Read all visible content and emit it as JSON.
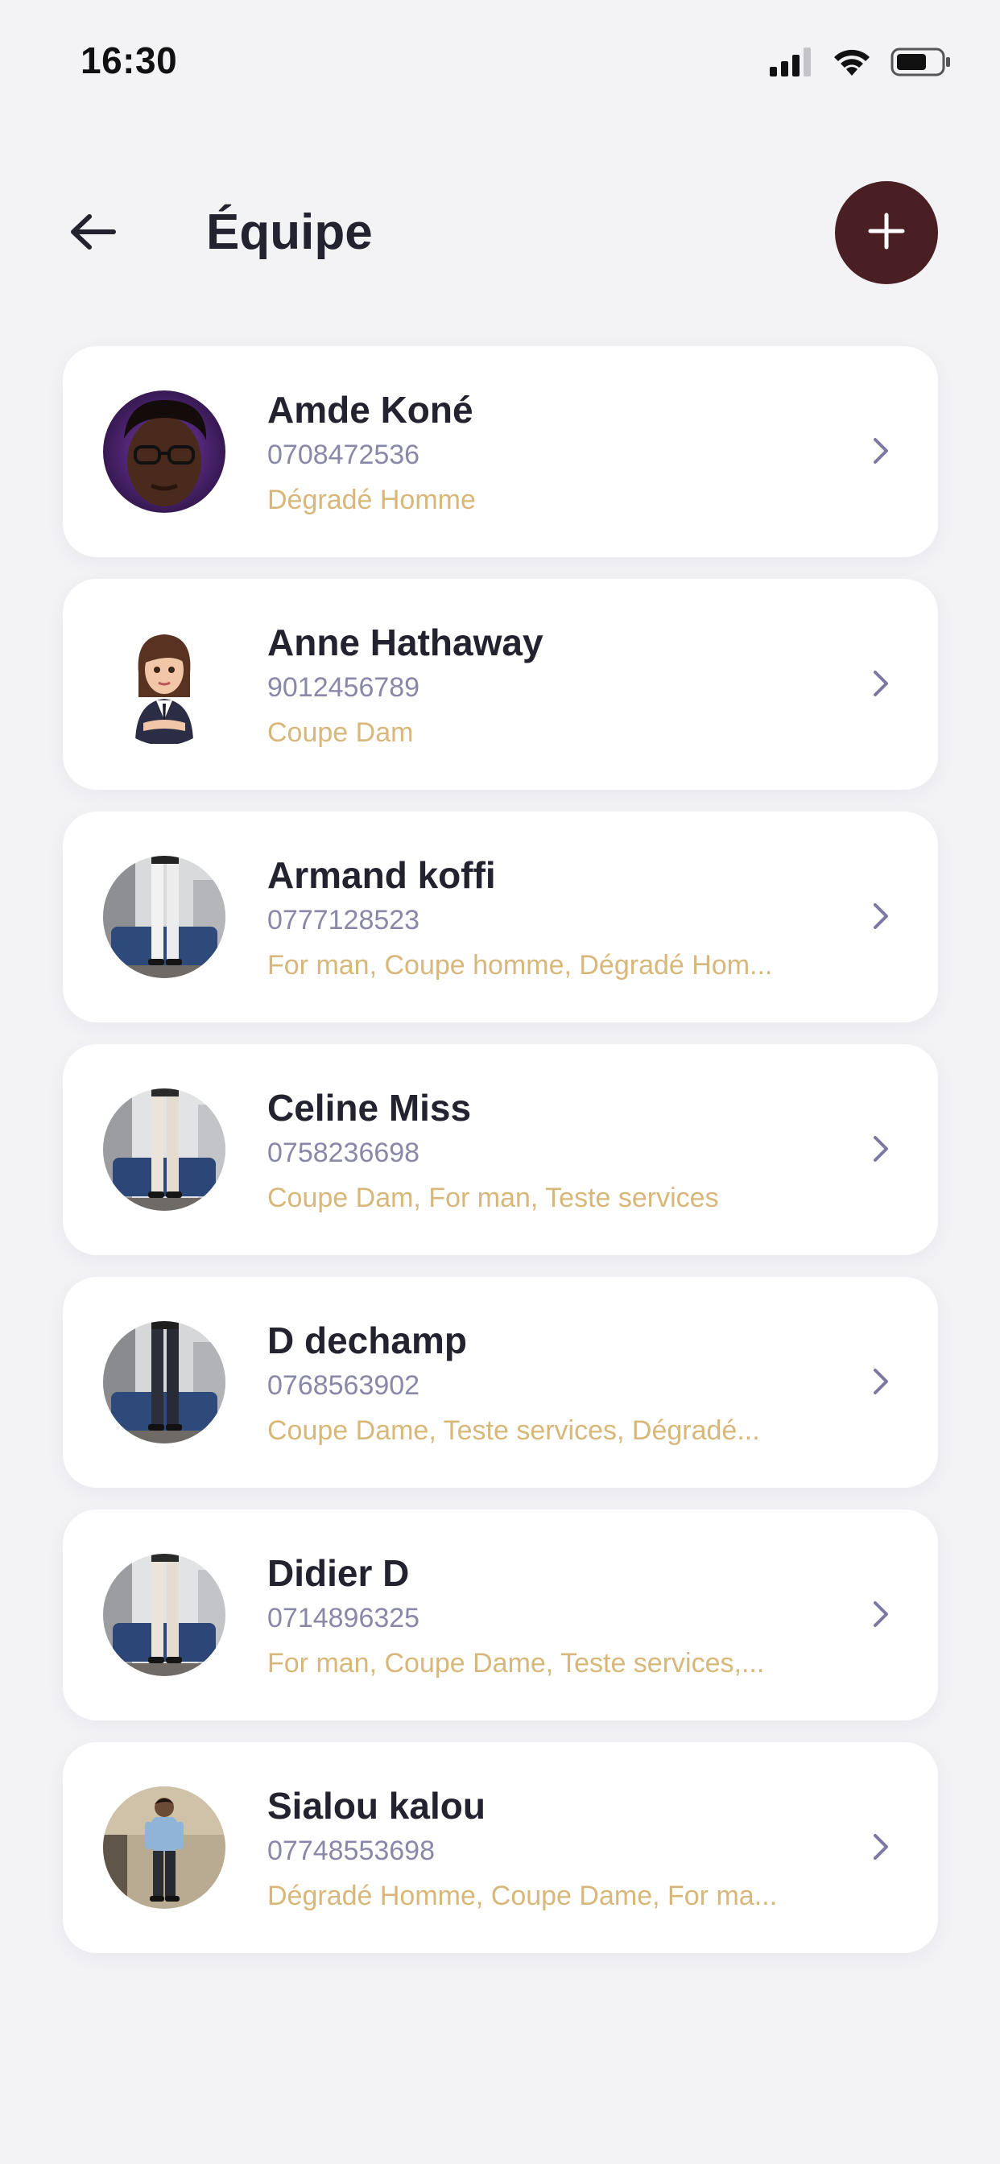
{
  "status": {
    "time": "16:30",
    "icons": [
      "signal-icon",
      "wifi-icon",
      "battery-icon"
    ]
  },
  "header": {
    "title": "Équipe",
    "back_icon": "arrow-left-icon",
    "add_icon": "plus-icon"
  },
  "colors": {
    "background": "#f3f3f6",
    "card": "#ffffff",
    "accent": "#4a1f24",
    "name": "#23222f",
    "phone": "#8a88a8",
    "services": "#d8b77a",
    "chevron": "#7b79a3"
  },
  "members": [
    {
      "name": "Amde Koné",
      "phone": "0708472536",
      "services": "Dégradé Homme",
      "avatar": "portrait-photo"
    },
    {
      "name": "Anne Hathaway",
      "phone": "9012456789",
      "services": "Coupe Dam",
      "avatar": "cartoon-woman-avatar"
    },
    {
      "name": "Armand koffi",
      "phone": "0777128523",
      "services": "For man, Coupe homme, Dégradé Hom...",
      "avatar": "outfit-photo"
    },
    {
      "name": "Celine Miss",
      "phone": "0758236698",
      "services": "Coupe Dam, For man, Teste services",
      "avatar": "outfit-photo"
    },
    {
      "name": "D dechamp",
      "phone": "0768563902",
      "services": "Coupe Dame, Teste services, Dégradé...",
      "avatar": "outfit-photo"
    },
    {
      "name": "Didier D",
      "phone": "0714896325",
      "services": "For man, Coupe Dame, Teste services,...",
      "avatar": "outfit-photo"
    },
    {
      "name": "Sialou kalou",
      "phone": "07748553698",
      "services": "Dégradé Homme, Coupe Dame, For ma...",
      "avatar": "man-standing-photo"
    }
  ]
}
